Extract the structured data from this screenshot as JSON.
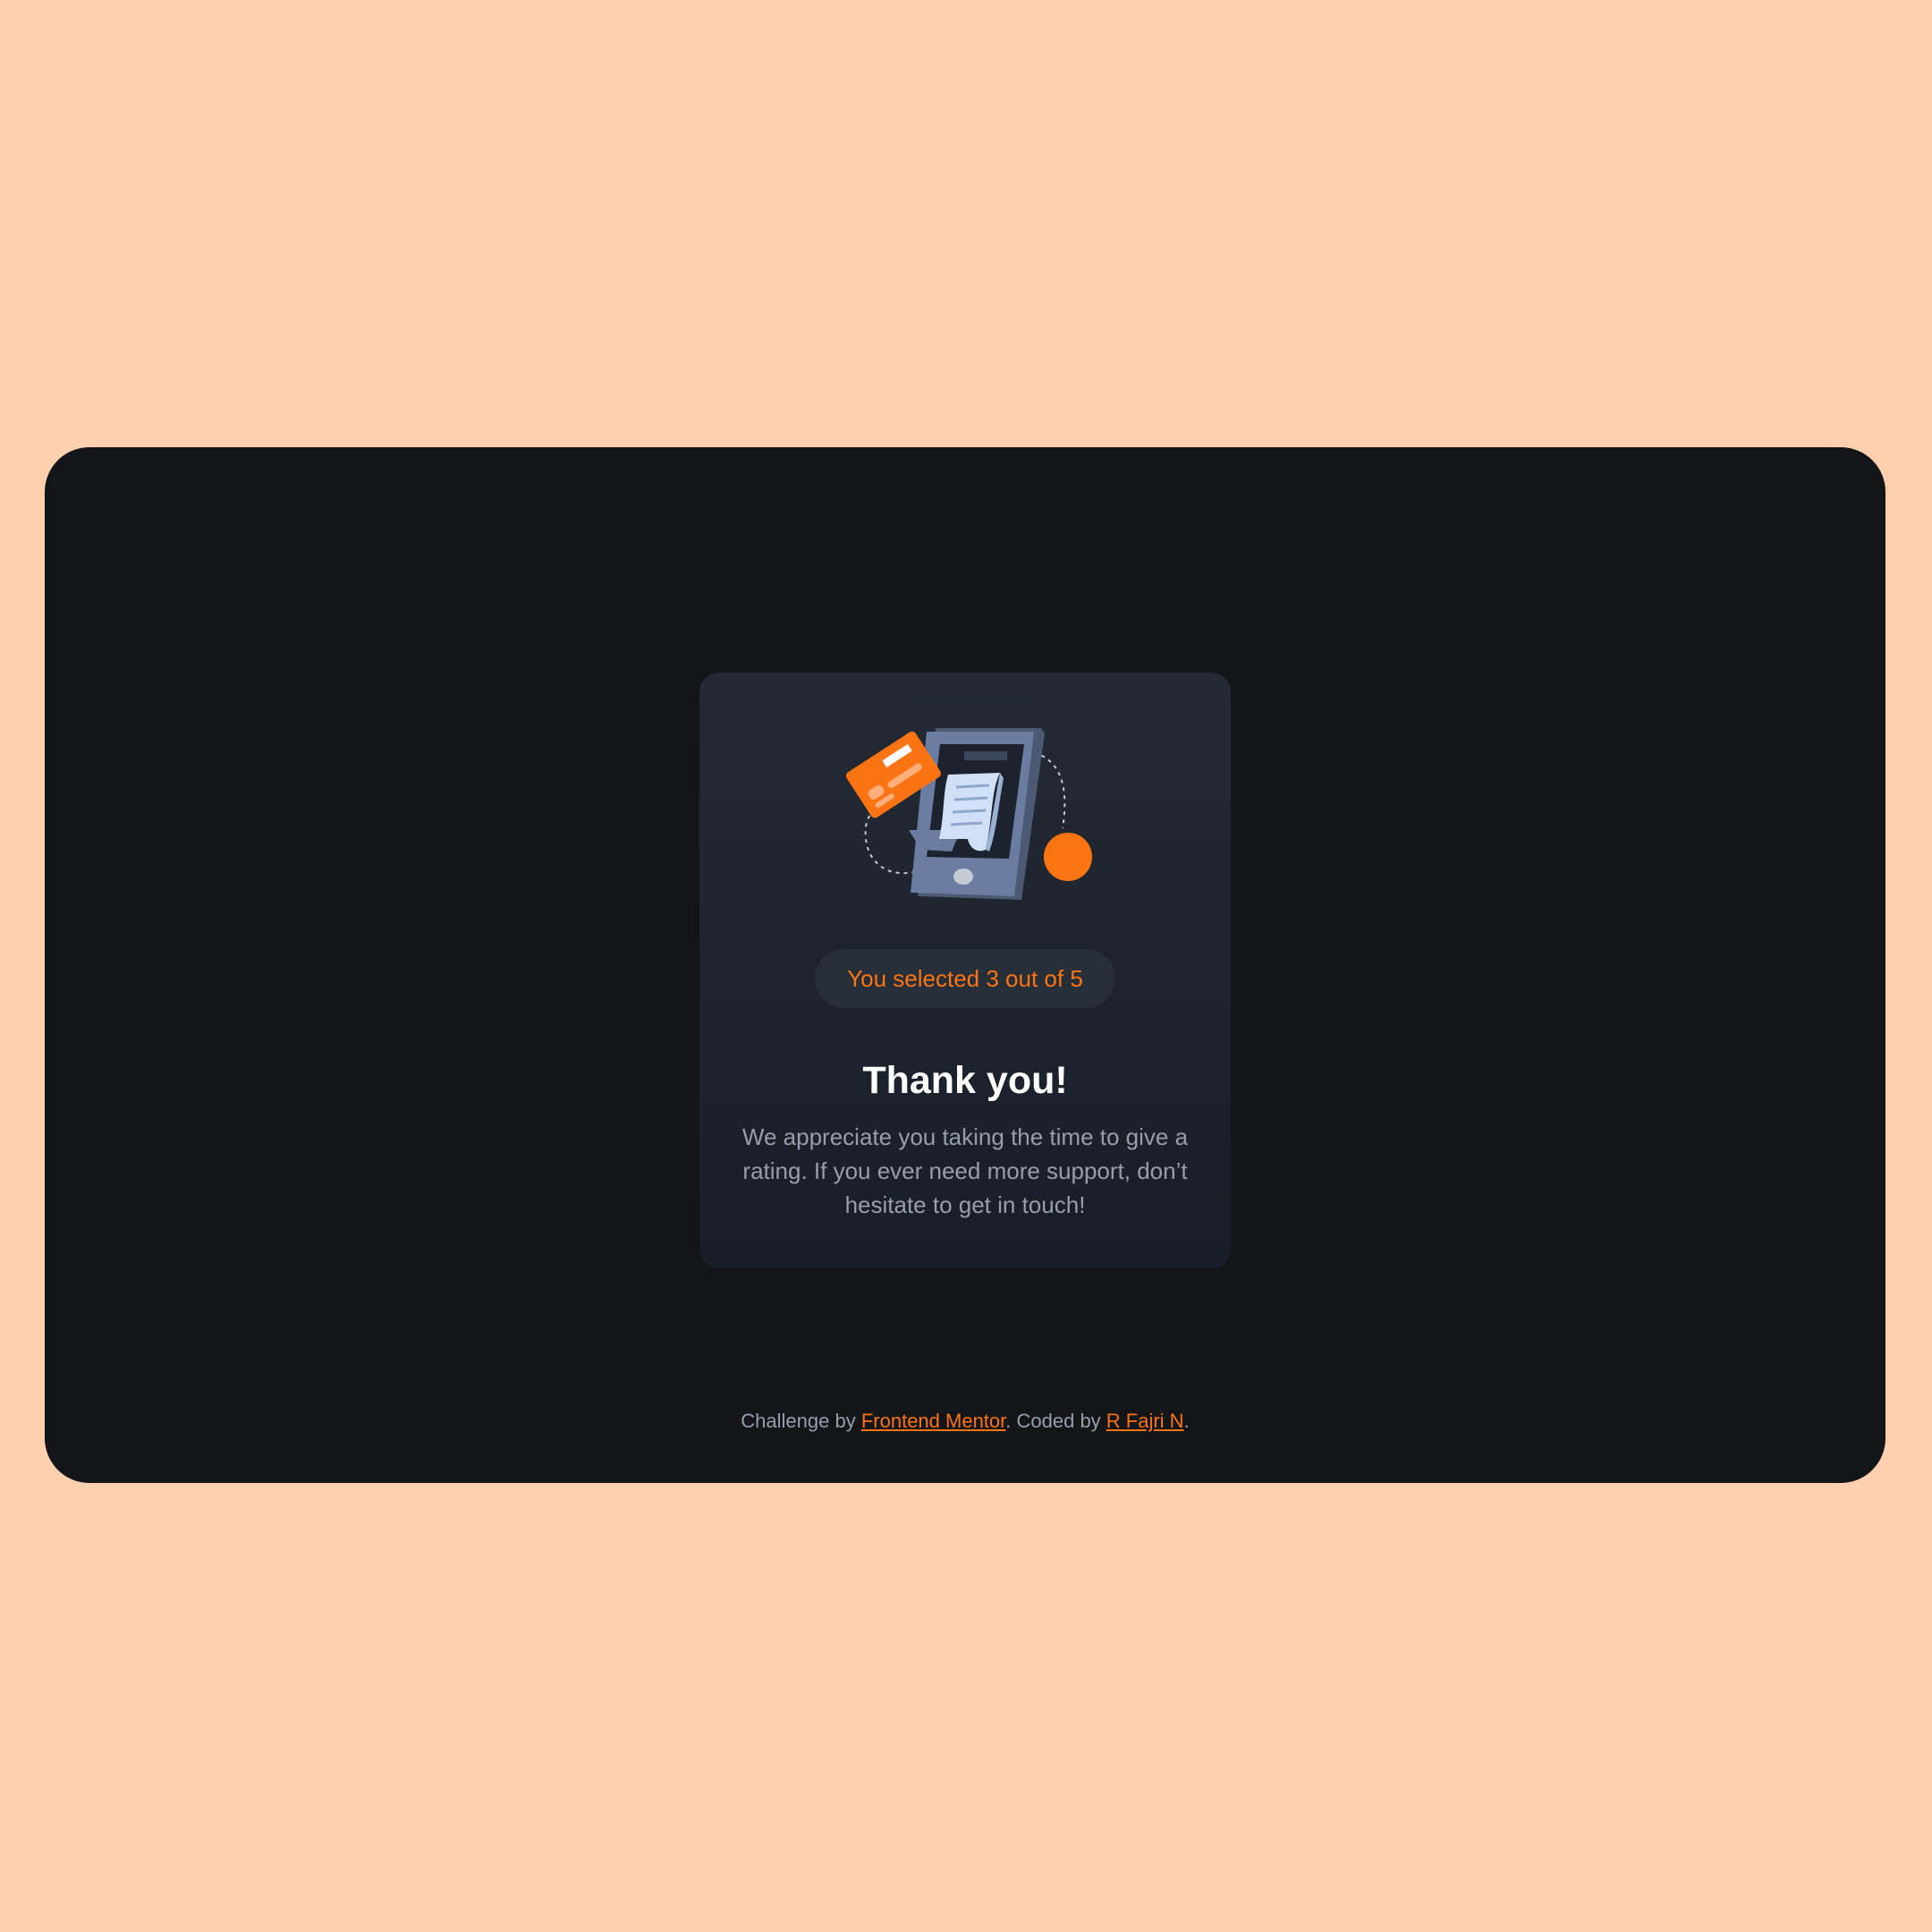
{
  "colors": {
    "page_background": "#ffd0ae",
    "window_background": "#131518",
    "accent": "#fb7413",
    "muted_text": "#959eac",
    "heading_text": "#ffffff"
  },
  "illustration": {
    "icon": "payment-phone-illustration"
  },
  "rating": {
    "selected_text": "You selected 3 out of 5"
  },
  "card": {
    "title": "Thank you!",
    "message": "We appreciate you taking the time to give a rating. If you ever need more support, don’t hesitate to get in touch!"
  },
  "attribution": {
    "prefix": "Challenge by ",
    "challenge_link": "Frontend Mentor",
    "middle": ". Coded by ",
    "author_link": "R Fajri N",
    "suffix": "."
  }
}
